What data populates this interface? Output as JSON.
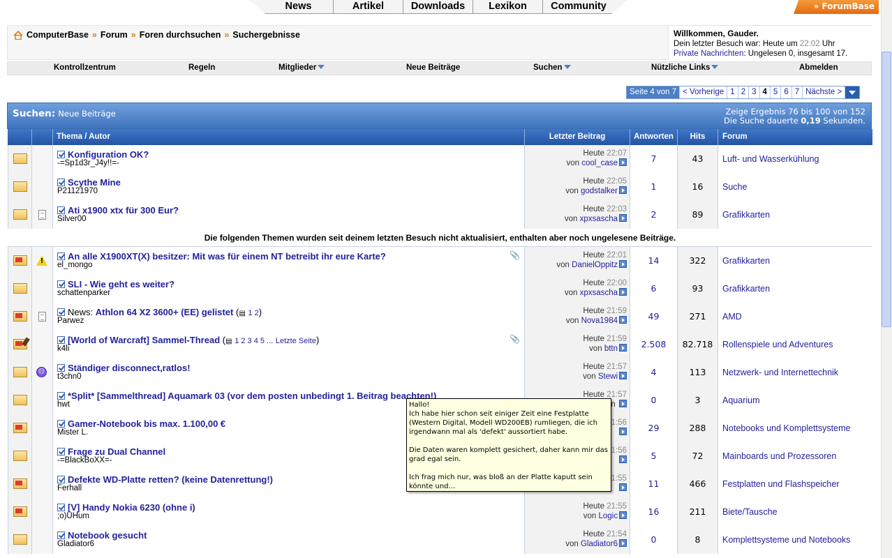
{
  "top_tabs": [
    "News",
    "Artikel",
    "Downloads",
    "Lexikon",
    "Community"
  ],
  "forumbase_label": "» ForumBase",
  "breadcrumb": {
    "home": "ComputerBase",
    "sep": "»",
    "items": [
      "Forum",
      "Foren durchsuchen",
      "Suchergebnisse"
    ]
  },
  "welcome": {
    "greeting": "Willkommen, Gauder.",
    "last_visit_prefix": "Dein letzter Besuch war: Heute um",
    "last_visit_time": "22:02",
    "last_visit_suffix": "Uhr",
    "pm_link": "Private Nachrichten",
    "pm_text": ": Ungelesen 0, insgesamt 17."
  },
  "nav": [
    "Kontrollzentrum",
    "Regeln",
    "Mitglieder",
    "Neue Beiträge",
    "Suchen",
    "Nützliche Links",
    "Abmelden"
  ],
  "pager": {
    "label": "Seite 4 von 7",
    "prev": "< Vorherige",
    "pages": [
      "1",
      "2",
      "3",
      "4",
      "5",
      "6",
      "7"
    ],
    "current": "4",
    "next": "Nächste >"
  },
  "results": {
    "title_bold": "Suchen:",
    "title_sub": "Neue Beiträge",
    "info_line1": "Zeige Ergebnis 76 bis 100 von 152",
    "info_line2_prefix": "Die Suche dauerte",
    "info_line2_time": "0,19",
    "info_line2_suffix": "Sekunden."
  },
  "columns": [
    "Thema / Autor",
    "Letzter Beitrag",
    "Antworten",
    "Hits",
    "Forum"
  ],
  "notice": "Die folgenden Themen wurden seit deinem letzten Besuch nicht aktualisiert, enthalten aber noch ungelesene Beiträge.",
  "rows_a": [
    {
      "title": "Konfiguration OK?",
      "author": "-=Sp1d3r_J4y!!=-",
      "day": "Heute",
      "time": "22:07",
      "by": "von",
      "user": "cool_case",
      "replies": "7",
      "hits": "43",
      "forum": "Luft- und Wasserkühlung"
    },
    {
      "title": "Scythe Mine",
      "author": "P21121970",
      "day": "Heute",
      "time": "22:05",
      "by": "von",
      "user": "godstalker",
      "replies": "1",
      "hits": "16",
      "forum": "Suche"
    },
    {
      "title": "Ati x1900 xtx für 300 Eur?",
      "author": "Silver00",
      "day": "Heute",
      "time": "22:03",
      "by": "von",
      "user": "xpxsascha",
      "replies": "2",
      "hits": "89",
      "forum": "Grafikkarten"
    }
  ],
  "rows_b": [
    {
      "title": "An alle X1900XT(X) besitzer: Mit was für einem NT betreibt ihr eure Karte?",
      "author": "el_mongo",
      "day": "Heute",
      "time": "22:01",
      "by": "von",
      "user": "DanielOppitz",
      "replies": "14",
      "hits": "322",
      "forum": "Grafikkarten"
    },
    {
      "title": "SLI - Wie geht es weiter?",
      "author": "schattenparker",
      "day": "Heute",
      "time": "22:00",
      "by": "von",
      "user": "xpxsascha",
      "replies": "6",
      "hits": "93",
      "forum": "Grafikkarten"
    },
    {
      "prefix": "News:",
      "title": "Athlon 64 X2 3600+ (EE) gelistet",
      "pages": "1 2",
      "author": "Parwez",
      "day": "Heute",
      "time": "21:59",
      "by": "von",
      "user": "Nova1984",
      "replies": "49",
      "hits": "271",
      "forum": "AMD"
    },
    {
      "title": "[World of Warcraft] Sammel-Thread",
      "pages": "1 2 3 4 5 ...",
      "last_page": "Letzte Seite",
      "author": "k4li",
      "day": "Heute",
      "time": "21:59",
      "by": "von",
      "user": "bttn",
      "replies": "2.508",
      "hits": "82.718",
      "forum": "Rollenspiele und Adventures"
    },
    {
      "title": "Ständiger disconnect,ratlos!",
      "author": "t3chn0",
      "day": "Heute",
      "time": "21:57",
      "by": "von",
      "user": "Stewi",
      "replies": "4",
      "hits": "113",
      "forum": "Netzwerk- und Internettechnik"
    },
    {
      "title": "*Split* [Sammelthread] Aquamark 03 (vor dem posten unbedingt 1. Beitrag beachten!)",
      "author": "hwt",
      "day": "Heute",
      "time": "21:57",
      "by": "von",
      "user": "",
      "replies": "0",
      "hits": "3",
      "forum": "Aquarium"
    },
    {
      "title": "Gamer-Notebook bis max. 1.100,00 €",
      "author": "Mister L.",
      "day": "",
      "time": "21:56",
      "by": "",
      "user": "",
      "replies": "29",
      "hits": "288",
      "forum": "Notebooks und Komplettsysteme"
    },
    {
      "title": "Frage zu Dual Channel",
      "author": "-=BlackBoXX=-",
      "day": "",
      "time": "21:56",
      "by": "",
      "user": "",
      "replies": "5",
      "hits": "72",
      "forum": "Mainboards und Prozessoren"
    },
    {
      "title": "Defekte WD-Platte retten? (keine Datenrettung!)",
      "author": "Ferhall",
      "day": "",
      "time": "21:55",
      "by": "",
      "user": "",
      "replies": "11",
      "hits": "466",
      "forum": "Festplatten und Flashspeicher"
    },
    {
      "title": "[V] Handy Nokia 6230 (ohne i)",
      "author": ";o)UHum",
      "day": "Heute",
      "time": "21:55",
      "by": "von",
      "user": "Logic",
      "replies": "16",
      "hits": "211",
      "forum": "Biete/Tausche"
    },
    {
      "title": "Notebook gesucht",
      "author": "Gladiator6",
      "day": "Heute",
      "time": "21:54",
      "by": "von",
      "user": "Gladiator6",
      "replies": "0",
      "hits": "8",
      "forum": "Komplettsysteme und Notebooks"
    }
  ],
  "tooltip": "Hallo!\nIch habe hier schon seit einiger Zeit eine Festplatte (Western Digital, Modell WD200EB) rumliegen, die ich irgendwann mal als 'defekt' aussortiert habe.\n\nDie Daten waren komplett gesichert, daher kann mir das grad egal sein.\n\nIch frag mich nur, was bloß an der Platte kaputt sein könnte und..."
}
